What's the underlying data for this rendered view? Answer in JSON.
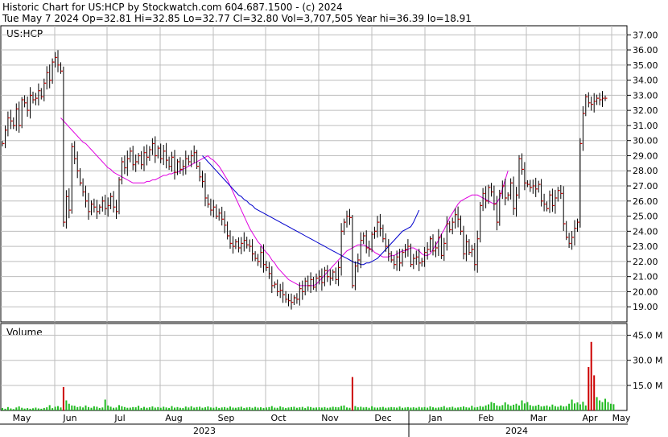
{
  "header": {
    "line1": "Historic Chart for US:HCP by Stockwatch.com 604.687.1500 - (c) 2024",
    "line2": "Tue May  7 2024  Op=32.81  Hi=32.85  Lo=32.77  Cl=32.80  Vol=3,707,505  Year hi=36.39  lo=18.91"
  },
  "chart_data": [
    {
      "type": "ohlc",
      "title": "US:HCP",
      "y_ticks": [
        "19.00",
        "20.00",
        "21.00",
        "22.00",
        "23.00",
        "24.00",
        "25.00",
        "26.00",
        "27.00",
        "28.00",
        "29.00",
        "30.00",
        "31.00",
        "32.00",
        "33.00",
        "34.00",
        "35.00",
        "36.00",
        "37.00"
      ],
      "ylim": [
        18.0,
        37.6
      ],
      "x_months": [
        "May",
        "Jun",
        "Jul",
        "Aug",
        "Sep",
        "Oct",
        "Nov",
        "Dec",
        "Jan",
        "Feb",
        "Mar",
        "Apr",
        "May"
      ],
      "x_years": [
        "2023",
        "2024"
      ],
      "grid": true,
      "series": [
        {
          "name": "price",
          "close": [
            29.8,
            30.7,
            31.5,
            31.3,
            31.0,
            32.1,
            31.0,
            32.7,
            32.5,
            32.0,
            33.0,
            32.7,
            32.8,
            33.3,
            32.9,
            33.8,
            34.5,
            34.0,
            35.2,
            35.5,
            35.0,
            34.6,
            24.6,
            26.3,
            25.4,
            29.6,
            28.8,
            28.0,
            27.2,
            26.6,
            26.0,
            25.3,
            25.8,
            25.6,
            25.3,
            25.6,
            26.0,
            25.5,
            25.7,
            26.3,
            25.6,
            25.3,
            27.4,
            28.6,
            28.2,
            28.8,
            29.3,
            28.4,
            28.6,
            29.0,
            28.4,
            29.2,
            28.9,
            29.4,
            29.8,
            29.0,
            29.5,
            28.8,
            29.3,
            28.7,
            28.3,
            28.9,
            27.9,
            28.6,
            28.1,
            28.3,
            28.8,
            28.6,
            29.0,
            29.2,
            28.3,
            27.6,
            27.3,
            26.2,
            25.8,
            25.4,
            25.6,
            25.0,
            25.2,
            24.8,
            24.4,
            23.7,
            23.2,
            23.0,
            23.3,
            22.9,
            23.2,
            23.4,
            23.1,
            23.0,
            22.5,
            22.2,
            22.0,
            22.6,
            21.8,
            21.6,
            21.2,
            20.4,
            20.5,
            20.0,
            20.1,
            19.8,
            19.5,
            19.4,
            19.3,
            19.6,
            19.5,
            20.2,
            20.0,
            20.7,
            20.4,
            20.8,
            20.3,
            20.9,
            21.0,
            20.6,
            21.4,
            21.0,
            20.9,
            21.3,
            20.8,
            21.6,
            24.0,
            24.6,
            25.0,
            24.9,
            20.4,
            21.7,
            22.1,
            23.4,
            23.7,
            22.9,
            22.8,
            23.8,
            24.0,
            24.6,
            24.2,
            23.5,
            23.0,
            22.5,
            22.1,
            21.8,
            22.3,
            21.9,
            22.6,
            22.8,
            23.0,
            21.8,
            22.2,
            22.3,
            21.9,
            22.0,
            22.6,
            22.8,
            23.5,
            22.7,
            22.9,
            23.6,
            22.4,
            23.2,
            24.5,
            24.1,
            24.6,
            25.1,
            24.8,
            24.0,
            22.5,
            23.3,
            22.6,
            22.8,
            21.8,
            23.5,
            25.7,
            26.5,
            26.0,
            26.9,
            26.6,
            25.8,
            24.6,
            26.5,
            27.0,
            26.2,
            26.4,
            27.2,
            25.5,
            26.4,
            28.8,
            28.1,
            27.2,
            27.1,
            26.9,
            27.0,
            26.8,
            27.1,
            26.0,
            25.8,
            25.5,
            26.4,
            25.7,
            26.2,
            26.7,
            26.5,
            24.5,
            23.6,
            23.2,
            23.6,
            24.2,
            24.6,
            29.8,
            31.8,
            32.9,
            32.5,
            32.4,
            32.6,
            32.8,
            32.7,
            32.8,
            32.8
          ]
        },
        {
          "name": "short moving average",
          "close_offset": 21,
          "values": [
            31.5,
            31.3,
            31.1,
            30.9,
            30.7,
            30.5,
            30.3,
            30.1,
            29.9,
            29.8,
            29.6,
            29.4,
            29.2,
            29.0,
            28.8,
            28.6,
            28.4,
            28.2,
            28.1,
            27.9,
            27.8,
            27.7,
            27.6,
            27.5,
            27.4,
            27.3,
            27.2,
            27.2,
            27.2,
            27.2,
            27.2,
            27.3,
            27.3,
            27.4,
            27.4,
            27.5,
            27.6,
            27.7,
            27.7,
            27.8,
            27.8,
            27.9,
            27.9,
            28.0,
            28.1,
            28.2,
            28.3,
            28.4,
            28.5,
            28.6,
            28.7,
            28.8,
            28.9,
            29.0,
            28.8,
            28.7,
            28.5,
            28.3,
            28.0,
            27.7,
            27.4,
            27.0,
            26.6,
            26.2,
            25.8,
            25.4,
            25.0,
            24.6,
            24.2,
            23.9,
            23.6,
            23.3,
            23.1,
            22.8,
            22.6,
            22.4,
            22.1,
            21.9,
            21.6,
            21.4,
            21.2,
            21.0,
            20.8,
            20.7,
            20.6,
            20.5,
            20.4,
            20.4,
            20.4,
            20.4,
            20.4,
            20.4,
            20.5,
            20.7,
            20.9,
            21.1,
            21.3,
            21.5,
            21.7,
            21.9,
            22.1,
            22.3,
            22.5,
            22.7,
            22.8,
            22.9,
            23.0,
            23.1,
            23.1,
            23.1,
            23.0,
            22.9,
            22.8,
            22.6,
            22.5,
            22.4,
            22.3,
            22.3,
            22.3,
            22.4,
            22.4,
            22.5,
            22.6,
            22.7,
            22.7,
            22.8,
            22.9,
            22.9,
            22.8,
            22.7,
            22.5,
            22.4,
            22.4,
            22.5,
            22.8,
            23.1,
            23.4,
            23.8,
            24.1,
            24.5,
            24.9,
            25.2,
            25.5,
            25.8,
            26.0,
            26.1,
            26.2,
            26.3,
            26.4,
            26.4,
            26.4,
            26.3,
            26.2,
            26.1,
            26.0,
            25.9,
            25.8,
            25.9,
            26.2,
            26.8,
            27.4,
            28.0
          ]
        },
        {
          "name": "long moving average",
          "close_offset": 72,
          "values": [
            29.0,
            28.8,
            28.6,
            28.4,
            28.2,
            28.0,
            27.8,
            27.6,
            27.4,
            27.2,
            27.0,
            26.8,
            26.6,
            26.4,
            26.3,
            26.1,
            26.0,
            25.8,
            25.7,
            25.5,
            25.4,
            25.3,
            25.2,
            25.1,
            25.0,
            24.9,
            24.8,
            24.7,
            24.6,
            24.5,
            24.4,
            24.3,
            24.2,
            24.1,
            24.0,
            23.9,
            23.8,
            23.7,
            23.6,
            23.5,
            23.4,
            23.3,
            23.2,
            23.1,
            23.0,
            22.9,
            22.8,
            22.7,
            22.6,
            22.5,
            22.4,
            22.3,
            22.2,
            22.1,
            22.0,
            21.9,
            21.9,
            21.8,
            21.8,
            21.9,
            21.9,
            22.0,
            22.1,
            22.2,
            22.4,
            22.6,
            22.8,
            23.0,
            23.2,
            23.4,
            23.6,
            23.8,
            24.0,
            24.1,
            24.2,
            24.3,
            24.6,
            25.0,
            25.4
          ]
        }
      ]
    },
    {
      "type": "bar",
      "title": "Volume",
      "y_ticks": [
        "15.0 M",
        "30.0 M",
        "45.0 M"
      ],
      "ylim": [
        0,
        52
      ],
      "values": [
        1.5,
        1.0,
        2.0,
        1.2,
        0.8,
        1.8,
        2.4,
        1.6,
        1.1,
        1.4,
        1.0,
        1.3,
        1.7,
        1.2,
        1.0,
        1.5,
        1.9,
        3.2,
        1.4,
        2.2,
        2.6,
        1.8,
        14.0,
        6.0,
        4.0,
        3.0,
        2.8,
        2.0,
        2.4,
        1.8,
        3.0,
        2.0,
        1.6,
        2.5,
        2.2,
        1.5,
        1.8,
        6.5,
        3.0,
        2.2,
        1.6,
        1.8,
        3.2,
        2.5,
        2.0,
        1.6,
        1.7,
        2.0,
        1.9,
        2.8,
        1.5,
        2.1,
        1.6,
        1.9,
        2.4,
        1.7,
        2.0,
        1.6,
        2.2,
        1.8,
        1.5,
        2.6,
        1.7,
        2.0,
        1.6,
        1.5,
        2.3,
        1.8,
        2.5,
        1.7,
        2.0,
        2.2,
        1.6,
        1.9,
        2.4,
        1.8,
        1.6,
        2.1,
        1.5,
        1.8,
        2.0,
        1.6,
        2.3,
        1.7,
        1.6,
        1.9,
        2.2,
        1.5,
        1.8,
        2.0,
        1.6,
        2.1,
        1.7,
        1.9,
        1.5,
        1.8,
        2.0,
        2.6,
        1.7,
        1.6,
        2.4,
        1.9,
        1.5,
        1.8,
        2.0,
        2.2,
        1.6,
        1.9,
        2.1,
        1.5,
        2.3,
        2.0,
        1.6,
        1.8,
        1.9,
        1.7,
        2.0,
        1.6,
        1.8,
        2.2,
        2.0,
        1.9,
        2.7,
        3.0,
        1.8,
        1.6,
        20.0,
        2.6,
        1.9,
        2.2,
        1.8,
        2.0,
        1.6,
        2.5,
        1.8,
        1.7,
        1.9,
        2.1,
        1.6,
        1.8,
        2.0,
        1.9,
        1.7,
        2.3,
        1.6,
        1.8,
        2.0,
        1.7,
        1.9,
        1.6,
        2.1,
        1.8,
        2.0,
        1.7,
        2.4,
        1.9,
        1.6,
        1.8,
        2.0,
        2.6,
        1.7,
        1.9,
        2.2,
        1.6,
        1.8,
        2.0,
        2.4,
        1.9,
        1.7,
        2.8,
        1.8,
        2.0,
        2.6,
        2.2,
        3.0,
        3.6,
        5.0,
        4.4,
        3.0,
        2.6,
        3.2,
        4.8,
        3.6,
        2.8,
        3.4,
        4.0,
        3.0,
        6.0,
        4.2,
        5.0,
        3.2,
        2.6,
        2.8,
        3.4,
        2.4,
        2.6,
        3.0,
        2.2,
        3.5,
        2.6,
        2.2,
        3.0,
        2.4,
        2.6,
        4.0,
        6.5,
        4.2,
        4.8,
        3.6,
        5.2,
        3.0,
        26.0,
        41.0,
        21.0,
        8.0,
        6.0,
        5.0,
        7.0,
        5.0,
        4.0,
        3.7
      ]
    }
  ],
  "colors": {
    "grid": "#bdbdbd",
    "up_bar": "#000000",
    "close_tick": "#cc0000",
    "short_ma": "#e000e0",
    "long_ma": "#0000cc",
    "volume": "#22bb22",
    "volume_spike": "#cc0000"
  }
}
